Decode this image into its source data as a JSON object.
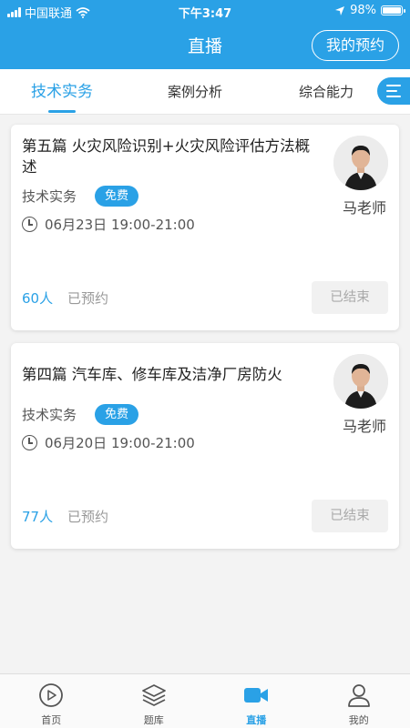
{
  "status_bar": {
    "carrier": "中国联通",
    "time": "下午3:47",
    "battery": "98%",
    "battery_level": 0.98
  },
  "header": {
    "title": "直播",
    "my_booking": "我的预约"
  },
  "tabs": [
    {
      "label": "技术实务",
      "active": true
    },
    {
      "label": "案例分析",
      "active": false
    },
    {
      "label": "综合能力",
      "active": false
    }
  ],
  "courses": [
    {
      "title": "第五篇 火灾风险识别+火灾风险评估方法概述",
      "subject": "技术实务",
      "badge": "免费",
      "time": "06月23日 19:00-21:00",
      "teacher": "马老师",
      "count": "60人",
      "reserved": "已预约",
      "status": "已结束"
    },
    {
      "title": "第四篇 汽车库、修车库及洁净厂房防火",
      "subject": "技术实务",
      "badge": "免费",
      "time": "06月20日 19:00-21:00",
      "teacher": "马老师",
      "count": "77人",
      "reserved": "已预约",
      "status": "已结束"
    }
  ],
  "bottom_nav": [
    {
      "label": "首页",
      "icon": "play-circle-icon",
      "active": false
    },
    {
      "label": "题库",
      "icon": "layers-icon",
      "active": false
    },
    {
      "label": "直播",
      "icon": "video-camera-icon",
      "active": true
    },
    {
      "label": "我的",
      "icon": "user-icon",
      "active": false
    }
  ],
  "colors": {
    "accent": "#2aa1e6",
    "background": "#f3f3f3"
  }
}
